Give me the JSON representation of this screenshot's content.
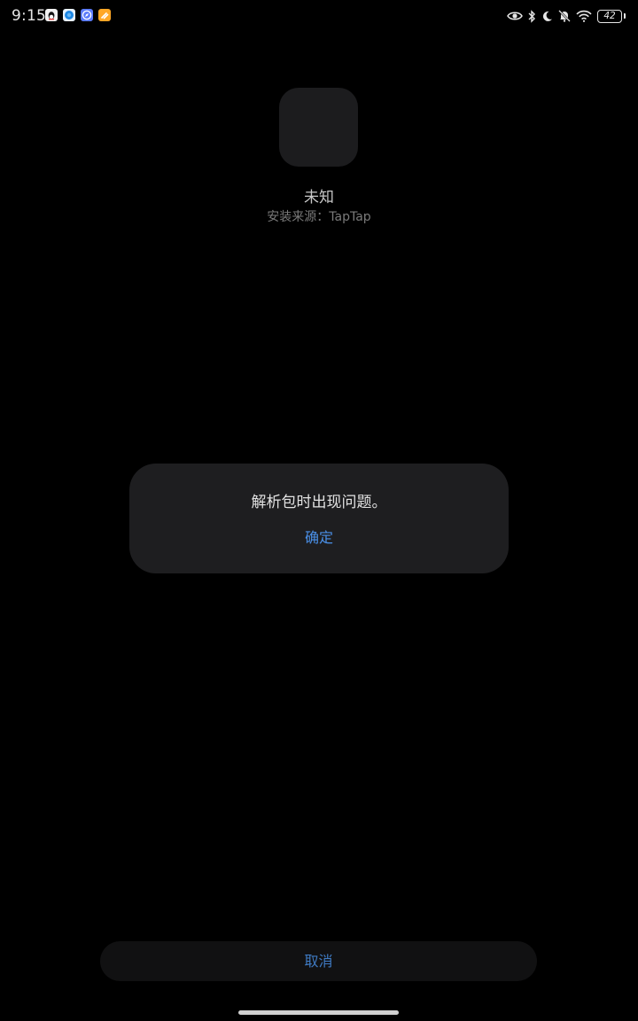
{
  "status_bar": {
    "time": "9:15",
    "notification_icons": [
      "qq-icon",
      "browser-icon",
      "compass-icon",
      "notes-icon"
    ],
    "system_icons": [
      "eye-icon",
      "bluetooth-icon",
      "moon-icon",
      "mute-bell-icon",
      "wifi-icon"
    ],
    "battery": "42"
  },
  "app": {
    "name": "未知",
    "install_source": "安装来源：TapTap"
  },
  "dialog": {
    "message": "解析包时出现问题。",
    "confirm_label": "确定"
  },
  "footer": {
    "cancel_label": "取消"
  },
  "colors": {
    "background": "#000000",
    "dialog_bg": "#1e1e20",
    "accent_blue": "#4a90e8"
  }
}
